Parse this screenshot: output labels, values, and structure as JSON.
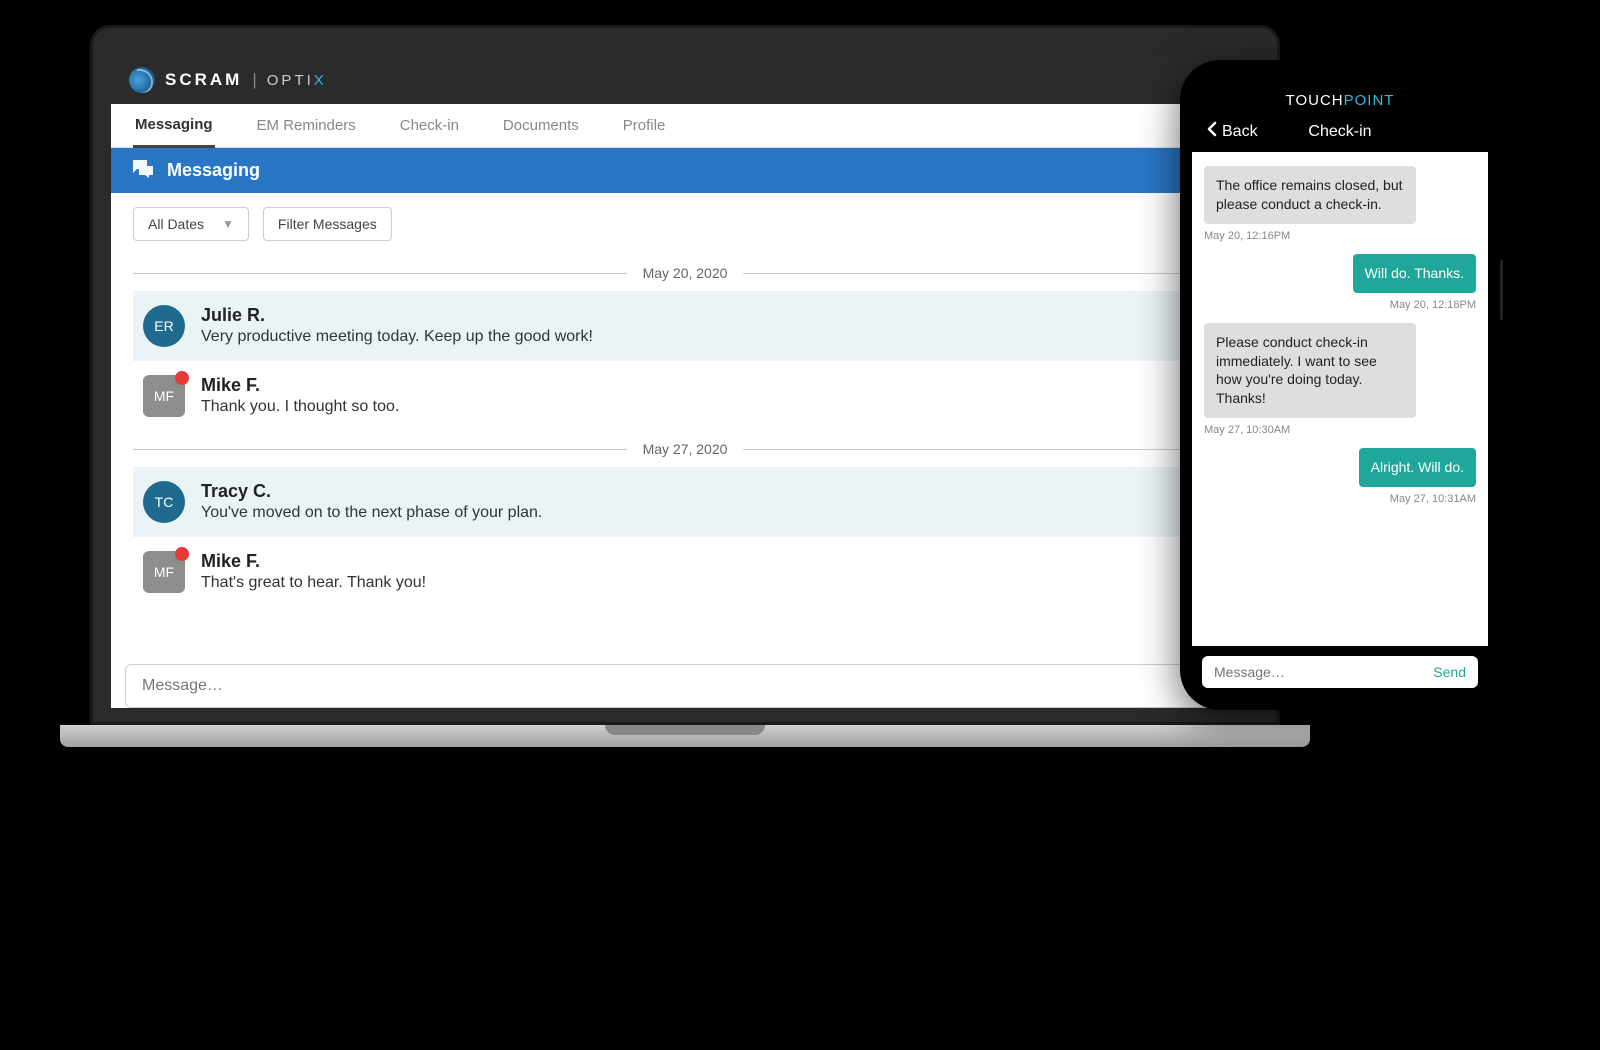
{
  "desktop": {
    "brand": {
      "scram": "SCRAM",
      "optix_prefix": "OPTI",
      "optix_suffix": "X"
    },
    "tabs": [
      "Messaging",
      "EM Reminders",
      "Check-in",
      "Documents",
      "Profile"
    ],
    "active_tab": "Messaging",
    "section_title": "Messaging",
    "filters": {
      "date_select": "All Dates",
      "filter_btn": "Filter Messages"
    },
    "dates": [
      "May 20, 2020",
      "May 27, 2020"
    ],
    "messages": [
      {
        "avatar": "ER",
        "shape": "circle",
        "dot": false,
        "name": "Julie R.",
        "text": "Very productive meeting today. Keep up the good work!",
        "highlight": true
      },
      {
        "avatar": "MF",
        "shape": "square",
        "dot": true,
        "name": "Mike F.",
        "text": "Thank you. I thought so too.",
        "highlight": false
      },
      {
        "avatar": "TC",
        "shape": "circle",
        "dot": false,
        "name": "Tracy C.",
        "text": "You've moved on to the next phase of your plan.",
        "highlight": true
      },
      {
        "avatar": "MF",
        "shape": "square",
        "dot": true,
        "name": "Mike F.",
        "text": "That's great to hear. Thank you!",
        "highlight": false
      }
    ],
    "composer_placeholder": "Message…"
  },
  "phone": {
    "brand": {
      "touch": "TOUCH",
      "point": "POINT"
    },
    "back_label": "Back",
    "title": "Check-in",
    "thread": [
      {
        "dir": "in",
        "text": "The office remains closed, but please conduct a check-in.",
        "stamp": "May 20, 12:16PM"
      },
      {
        "dir": "out",
        "text": "Will do. Thanks.",
        "stamp": "May 20, 12:18PM"
      },
      {
        "dir": "in",
        "text": "Please conduct check-in immediately. I want to see how you're doing today. Thanks!",
        "stamp": "May 27, 10:30AM"
      },
      {
        "dir": "out",
        "text": "Alright. Will do.",
        "stamp": "May 27, 10:31AM"
      }
    ],
    "composer_placeholder": "Message…",
    "send_label": "Send"
  }
}
